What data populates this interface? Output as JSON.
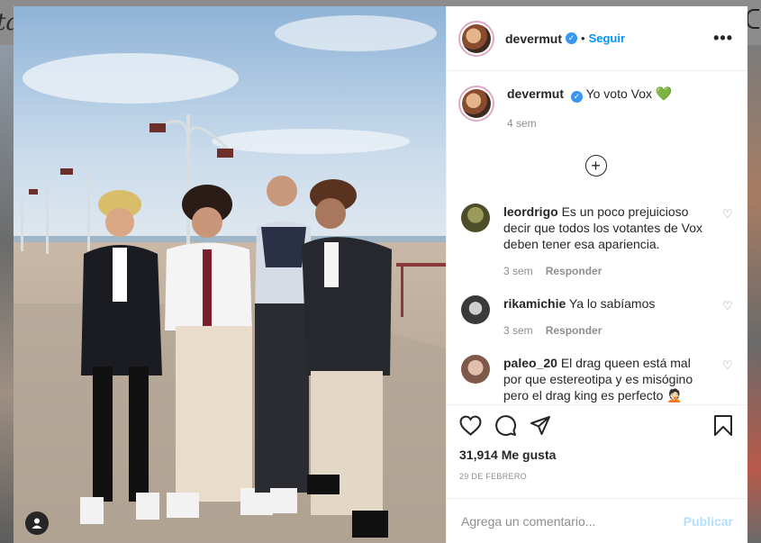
{
  "backdrop": {
    "logo_fragment": "ta"
  },
  "post": {
    "author": "devermut",
    "follow_label": "Seguir",
    "dot": "•",
    "more_label": "•••",
    "caption_text": "Yo voto Vox",
    "caption_emoji": "💚",
    "caption_time": "4 sem",
    "load_more": "+",
    "likes": "31,914 Me gusta",
    "date": "29 DE FEBRERO",
    "comment_placeholder": "Agrega un comentario...",
    "publish_label": "Publicar"
  },
  "comments": [
    {
      "user": "leordrigo",
      "text": "Es un poco prejuicioso decir que todos los votantes de Vox deben tener esa apariencia.",
      "time": "3 sem",
      "reply": "Responder",
      "avatar_color": "#6b6a3a"
    },
    {
      "user": "rikamichie",
      "text": "Ya lo sabíamos",
      "time": "3 sem",
      "reply": "Responder",
      "avatar_color": "#3a3a3a"
    },
    {
      "user": "paleo_20",
      "text": "El drag queen está mal por que estereotipa y es misógino pero el drag king es perfecto 🤦🏻",
      "time": "",
      "reply": "",
      "avatar_color": "#b88b78"
    }
  ],
  "colors": {
    "accent": "#0095f6",
    "verified": "#3897f0",
    "muted": "#8e8e8e"
  },
  "icons": [
    "heart-icon",
    "comment-icon",
    "share-icon",
    "bookmark-icon",
    "user-icon",
    "verified-icon"
  ]
}
